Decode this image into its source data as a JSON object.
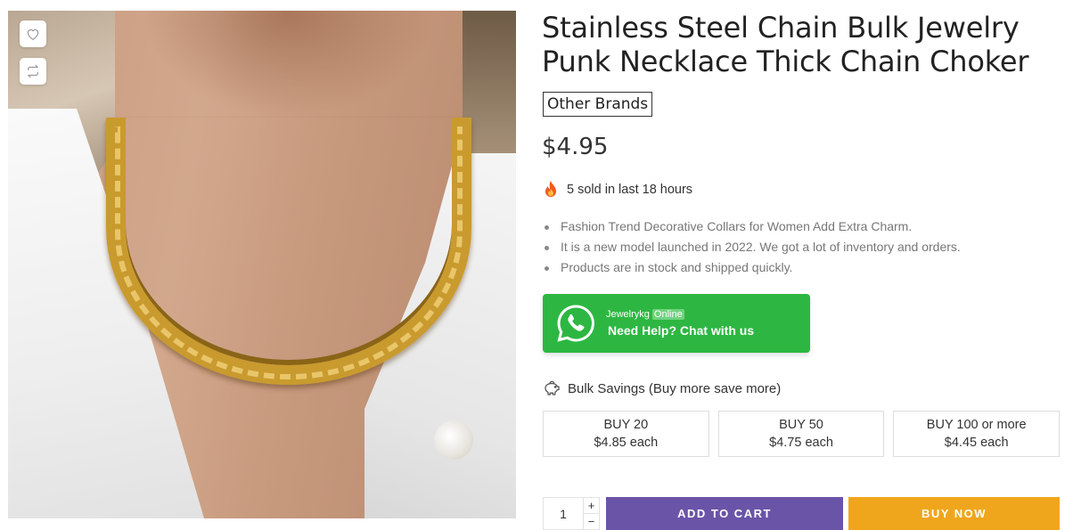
{
  "product": {
    "title": "Stainless Steel Chain Bulk Jewelry Punk Necklace Thick Chain Choker",
    "brand": "Other Brands",
    "price": "$4.95",
    "sold_text": "5 sold in last 18 hours",
    "bullets": [
      "Fashion Trend Decorative Collars for Women Add Extra Charm.",
      "It is a new model launched in 2022. We got a lot of inventory and orders.",
      "Products are in stock and shipped quickly."
    ]
  },
  "image_actions": {
    "wishlist_icon": "heart-icon",
    "compare_icon": "compare-icon"
  },
  "whatsapp": {
    "name": "Jewelrykg",
    "status": "Online",
    "cta": "Need Help? Chat with us",
    "color": "#2db742"
  },
  "bulk": {
    "heading": "Bulk Savings (Buy more save more)",
    "tiers": [
      {
        "qty": "BUY 20",
        "price": "$4.85 each"
      },
      {
        "qty": "BUY 50",
        "price": "$4.75 each"
      },
      {
        "qty": "BUY 100 or more",
        "price": "$4.45 each"
      }
    ]
  },
  "cart": {
    "quantity": "1",
    "plus": "+",
    "minus": "−",
    "add_to_cart": "ADD TO CART",
    "buy_now": "BUY NOW",
    "add_color": "#6a54a8",
    "buy_color": "#f0a61c"
  }
}
